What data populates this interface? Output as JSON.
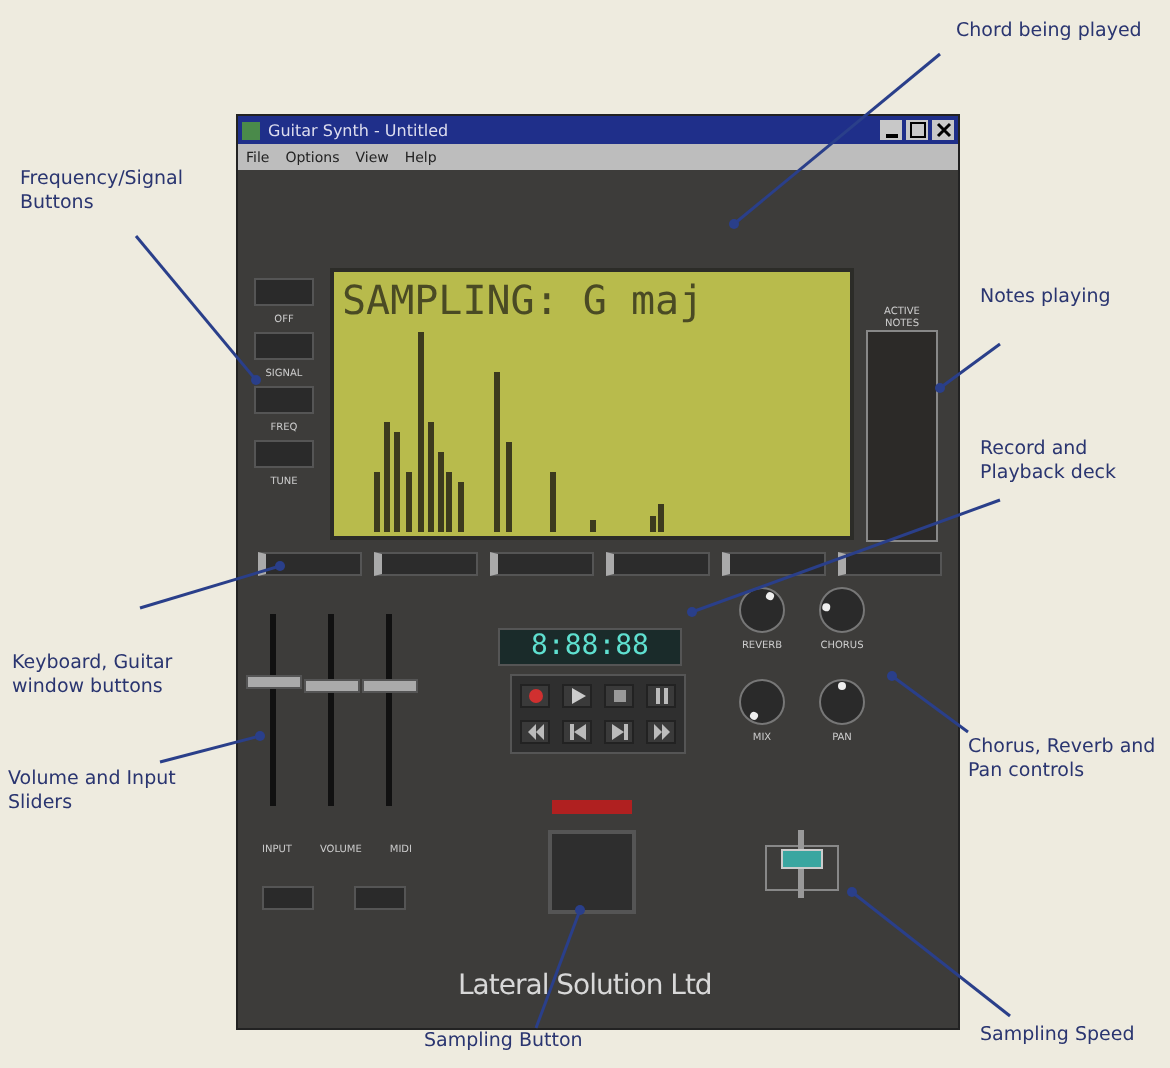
{
  "callouts": [
    {
      "text": "Chord being played"
    },
    {
      "text": "Frequency/Signal Buttons"
    },
    {
      "text": "Notes playing"
    },
    {
      "text": "Record and Playback deck"
    },
    {
      "text": "Keyboard, Guitar window buttons"
    },
    {
      "text": "Chorus, Reverb and Pan controls"
    },
    {
      "text": "Volume and Input Sliders"
    },
    {
      "text": "Sampling Button"
    },
    {
      "text": "Sampling Speed"
    }
  ],
  "window": {
    "title": "Guitar Synth - Untitled",
    "menu": [
      "File",
      "Options",
      "View",
      "Help"
    ]
  },
  "display": {
    "text": "SAMPLING: G maj"
  },
  "side_buttons": [
    {
      "label": "OFF"
    },
    {
      "label": "SIGNAL"
    },
    {
      "label": "FREQ"
    },
    {
      "label": "TUNE"
    }
  ],
  "meter": {
    "label": "ACTIVE NOTES"
  },
  "counter": "8:88:88",
  "transport": [
    {
      "kind": "record"
    },
    {
      "kind": "play"
    },
    {
      "kind": "stop"
    },
    {
      "kind": "pause"
    },
    {
      "kind": "rewind"
    },
    {
      "kind": "back"
    },
    {
      "kind": "forward"
    },
    {
      "kind": "end"
    }
  ],
  "knobs": [
    {
      "label": "REVERB"
    },
    {
      "label": "CHORUS"
    },
    {
      "label": "MIX"
    },
    {
      "label": "PAN"
    }
  ],
  "sliders": [
    {
      "label": "INPUT",
      "level": 0.65
    },
    {
      "label": "VOLUME",
      "level": 0.62
    },
    {
      "label": "MIDI",
      "level": 0.63
    }
  ],
  "footer": "Lateral Solution Ltd"
}
